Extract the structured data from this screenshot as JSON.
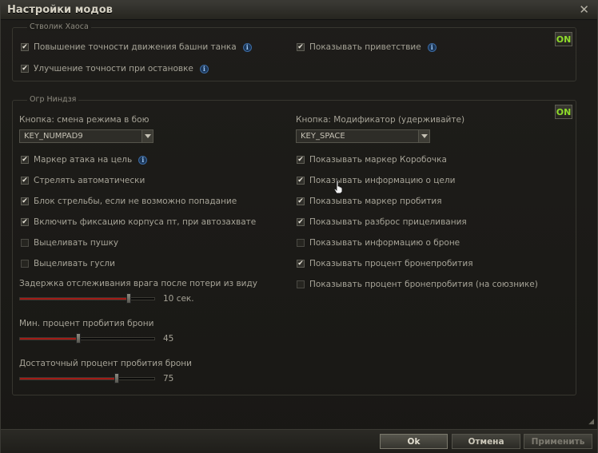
{
  "window": {
    "title": "Настройки модов",
    "close_glyph": "✕"
  },
  "group1": {
    "legend": "Стволик Хаоса",
    "on_label": "ON",
    "items": [
      {
        "label": "Повышение точности движения башни танка",
        "checked": true,
        "info": true
      },
      {
        "label": "Улучшение точности при остановке",
        "checked": true,
        "info": true
      },
      {
        "label": "Показывать приветствие",
        "checked": true,
        "info": true
      }
    ]
  },
  "group2": {
    "legend": "Огр Ниндзя",
    "on_label": "ON",
    "dropdown1": {
      "label": "Кнопка: смена режима в бою",
      "value": "KEY_NUMPAD9"
    },
    "dropdown2": {
      "label": "Кнопка: Модификатор (удерживайте)",
      "value": "KEY_SPACE"
    },
    "left_items": [
      {
        "label": "Маркер атака на цель",
        "checked": true,
        "info": true
      },
      {
        "label": "Стрелять автоматически",
        "checked": true
      },
      {
        "label": "Блок стрельбы, если не возможно попадание",
        "checked": true
      },
      {
        "label": "Включить фиксацию корпуса пт, при автозахвате",
        "checked": true
      },
      {
        "label": "Выцеливать пушку",
        "checked": false
      },
      {
        "label": "Выцеливать гусли",
        "checked": false
      }
    ],
    "right_items": [
      {
        "label": "Показывать маркер Коробочка",
        "checked": true
      },
      {
        "label": "Показывать информацию о цели",
        "checked": true
      },
      {
        "label": "Показывать маркер пробития",
        "checked": true
      },
      {
        "label": "Показывать разброс прицеливания",
        "checked": true
      },
      {
        "label": "Показывать информацию о броне",
        "checked": false
      },
      {
        "label": "Показывать процент бронепробития",
        "checked": true
      },
      {
        "label": "Показывать процент бронепробития (на союзнике)",
        "checked": false
      }
    ],
    "sliders": [
      {
        "label": "Задержка отслеживания врага после потери из виду",
        "value_text": "10 сек.",
        "fraction": 0.82
      },
      {
        "label": "Мин. процент пробития брони",
        "value_text": "45",
        "fraction": 0.43
      },
      {
        "label": "Достаточный процент пробития брони",
        "value_text": "75",
        "fraction": 0.73
      }
    ]
  },
  "buttons": {
    "ok": "Ok",
    "cancel": "Отмена",
    "apply": "Применить"
  },
  "colors": {
    "accent_on": "#8fdc2a",
    "slider_fill": "#a31b16",
    "info_icon": "#3c6aa1"
  }
}
